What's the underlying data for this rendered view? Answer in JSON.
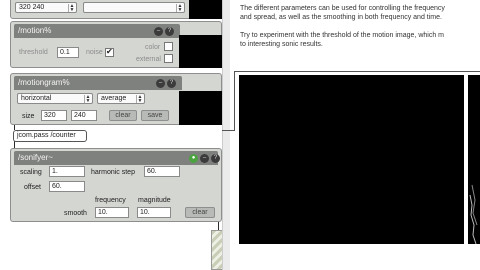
{
  "top_row": {
    "size_value": "320 240",
    "menu_value": ""
  },
  "motion": {
    "title": "/motion%",
    "threshold_label": "threshold",
    "threshold_value": "0.1",
    "noise_label": "noise",
    "noise_checked": true,
    "color_label": "color",
    "external_label": "external"
  },
  "motiongram": {
    "title": "/motiongram%",
    "direction_value": "horizontal",
    "mode_value": "average",
    "size_label": "size",
    "width_value": "320",
    "height_value": "240",
    "clear_label": "clear",
    "save_label": "save"
  },
  "pass_object": "jcom.pass /counter",
  "sonifyer": {
    "title": "/sonifyer~",
    "scaling_label": "scaling",
    "scaling_value": "1.",
    "harmonic_label": "harmonic step",
    "harmonic_value": "60.",
    "offset_label": "offset",
    "offset_value": "60.",
    "frequency_label": "frequency",
    "magnitude_label": "magnitude",
    "smooth_label": "smooth",
    "frequency_value": "10.",
    "magnitude_value": "10.",
    "clear_label": "clear"
  },
  "doc": {
    "line1": "The different parameters can be used for controlling the frequency",
    "line2": "and spread, as well as the smoothing in both frequency and time.",
    "line3": "Try to experiment with the threshold of the motion image, which m",
    "line4": "to interesting sonic results."
  }
}
